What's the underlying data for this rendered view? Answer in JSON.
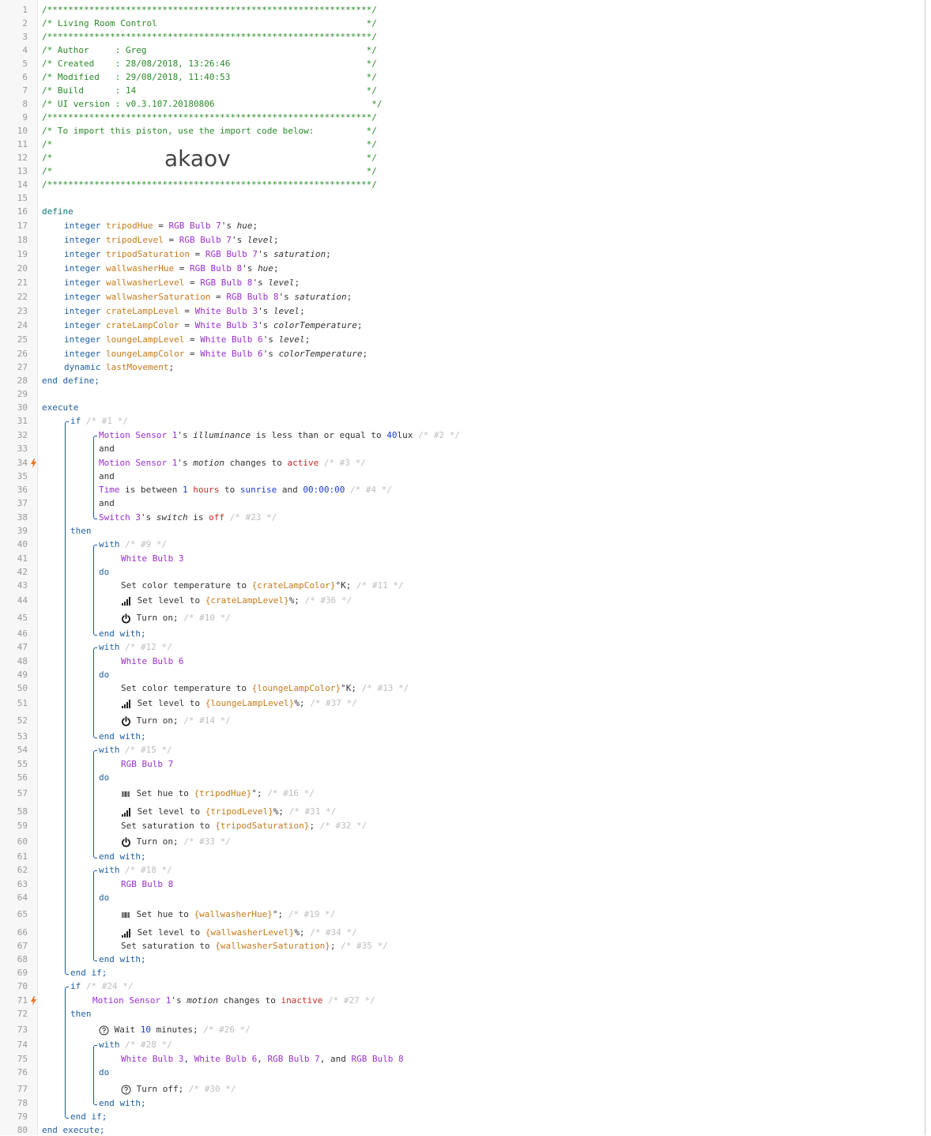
{
  "header": {
    "border": "/**************************************************************/",
    "title_line": "/* Living Room Control                                        */",
    "author_line": "/* Author     : Greg                                          */",
    "created_line": "/* Created    : 28/08/2018, 13:26:46                          */",
    "modified_line": "/* Modified   : 29/08/2018, 11:40:53                          */",
    "build_line": "/* Build      : 14                                            */",
    "uiversion_line": "/* UI version : v0.3.107.20180806                              */",
    "import_line": "/* To import this piston, use the import code below:          */",
    "blank_line": "/*                                                            */",
    "import_code": "akaov"
  },
  "line_numbers": [
    "1",
    "2",
    "3",
    "4",
    "5",
    "6",
    "7",
    "8",
    "9",
    "10",
    "11",
    "12",
    "13",
    "14",
    "15",
    "16",
    "17",
    "18",
    "19",
    "20",
    "21",
    "22",
    "23",
    "24",
    "25",
    "26",
    "27",
    "28",
    "29",
    "30",
    "31",
    "32",
    "33",
    "34",
    "35",
    "36",
    "37",
    "38",
    "39",
    "40",
    "41",
    "42",
    "43",
    "44",
    "45",
    "46",
    "47",
    "48",
    "49",
    "50",
    "51",
    "52",
    "53",
    "54",
    "55",
    "56",
    "57",
    "58",
    "59",
    "60",
    "61",
    "62",
    "63",
    "64",
    "65",
    "66",
    "67",
    "68",
    "69",
    "70",
    "71",
    "72",
    "73",
    "74",
    "75",
    "76",
    "77",
    "78",
    "79",
    "80"
  ],
  "code": {
    "define": "define",
    "end_define": "end define;",
    "integer": "integer",
    "dynamic": "dynamic",
    "eq": " = ",
    "s": "'s ",
    "semi": ";",
    "defs": [
      {
        "name": "tripodHue",
        "device": "RGB Bulb 7",
        "attr": "hue"
      },
      {
        "name": "tripodLevel",
        "device": "RGB Bulb 7",
        "attr": "level"
      },
      {
        "name": "tripodSaturation",
        "device": "RGB Bulb 7",
        "attr": "saturation"
      },
      {
        "name": "wallwasherHue",
        "device": "RGB Bulb 8",
        "attr": "hue"
      },
      {
        "name": "wallwasherLevel",
        "device": "RGB Bulb 8",
        "attr": "level"
      },
      {
        "name": "wallwasherSaturation",
        "device": "RGB Bulb 8",
        "attr": "saturation"
      },
      {
        "name": "crateLampLevel",
        "device": "White Bulb 3",
        "attr": "level"
      },
      {
        "name": "crateLampColor",
        "device": "White Bulb 3",
        "attr": "colorTemperature"
      },
      {
        "name": "loungeLampLevel",
        "device": "White Bulb 6",
        "attr": "level"
      },
      {
        "name": "loungeLampColor",
        "device": "White Bulb 6",
        "attr": "colorTemperature"
      }
    ],
    "last_movement": "lastMovement",
    "execute": "execute",
    "end_execute": "end execute;",
    "if": "if",
    "then": "then",
    "and": "and",
    "with": "with",
    "do": "do",
    "end_with": "end with;",
    "end_if": "end if;",
    "n1": "/* #1 */",
    "n2": "/* #2 */",
    "n3": "/* #3 */",
    "n4": "/* #4 */",
    "n23": "/* #23 */",
    "n9": "/* #9 */",
    "n11": "/* #11 */",
    "n36": "/* #36 */",
    "n10": "/* #10 */",
    "n12": "/* #12 */",
    "n13": "/* #13 */",
    "n37": "/* #37 */",
    "n14": "/* #14 */",
    "n15": "/* #15 */",
    "n16": "/* #16 */",
    "n31": "/* #31 */",
    "n32": "/* #32 */",
    "n33": "/* #33 */",
    "n18": "/* #18 */",
    "n19": "/* #19 */",
    "n34": "/* #34 */",
    "n35": "/* #35 */",
    "n24": "/* #24 */",
    "n27": "/* #27 */",
    "n26": "/* #26 */",
    "n28": "/* #28 */",
    "n30": "/* #30 */",
    "motion_sensor": "Motion Sensor 1",
    "illuminance": "illuminance",
    "lte": " is less than or equal to ",
    "lux_val": "40",
    "lux": "lux",
    "motion": "motion",
    "changes_to": " changes to ",
    "active": "active",
    "inactive": "inactive",
    "time": "Time",
    "is_between": " is between ",
    "one": "1",
    "hours": " hours",
    "to": " to ",
    "sunrise": "sunrise",
    "and_sp": " and ",
    "midnight": "00:00:00",
    "switch3": "Switch 3",
    "switch": "switch",
    "is": " is ",
    "off": "off",
    "white3": "White Bulb 3",
    "white6": "White Bulb 6",
    "rgb7": "RGB Bulb 7",
    "rgb8": "RGB Bulb 8",
    "set_ct": "Set color temperature to ",
    "set_level": "Set level to ",
    "set_hue": "Set hue to ",
    "set_sat": "Set saturation to ",
    "turn_on": "Turn on;",
    "turn_off": "Turn off;",
    "crate_color_expr": "{crateLampColor}",
    "crate_level_expr": "{crateLampLevel}",
    "lounge_color_expr": "{loungeLampColor}",
    "lounge_level_expr": "{loungeLampLevel}",
    "tripod_hue_expr": "{tripodHue}",
    "tripod_level_expr": "{tripodLevel}",
    "tripod_sat_expr": "{tripodSaturation}",
    "ww_hue_expr": "{wallwasherHue}",
    "ww_level_expr": "{wallwasherLevel}",
    "ww_sat_expr": "{wallwasherSaturation}",
    "k_suffix": "°K;",
    "pct_suffix": "%;",
    "deg_suffix": "°;",
    "semi_suffix": ";",
    "wait": "Wait ",
    "ten": "10",
    "minutes": " minutes;",
    "comma": ", ",
    "comma_and": ", and "
  },
  "colors": {
    "comment": "#2a8a2a",
    "keyword": "#0a7a7a",
    "device": "#9a2fd0",
    "variable": "#c47a1a",
    "number": "#1a3cd0",
    "value": "#c8282a",
    "note": "#bdbdbd",
    "trigger": "#e8742a"
  },
  "icons": [
    "trigger-bolt-icon",
    "signal-bars-icon",
    "power-icon",
    "hue-gradient-icon",
    "clock-question-icon"
  ]
}
